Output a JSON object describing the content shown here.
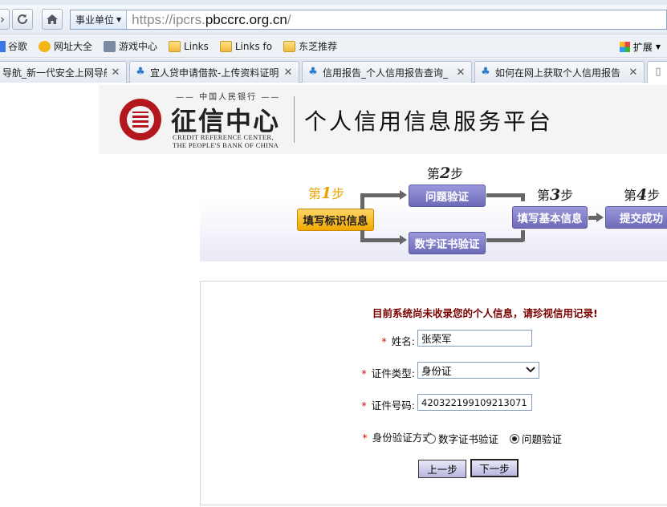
{
  "browser": {
    "zone_label": "事业单位",
    "url_prefix": "https://ipcrs.",
    "url_domain": "pbccrc.org.cn",
    "url_suffix": "/",
    "bookmarks": [
      {
        "label": "谷歌",
        "icon": "google-icon"
      },
      {
        "label": "网址大全",
        "icon": "nav-icon"
      },
      {
        "label": "游戏中心",
        "icon": "game-icon"
      },
      {
        "label": "Links",
        "icon": "folder-icon"
      },
      {
        "label": "Links fo",
        "icon": "folder-icon"
      },
      {
        "label": "东芝推荐",
        "icon": "folder-icon"
      }
    ],
    "extensions_label": "扩展",
    "tabs": [
      {
        "title": "导航_新一代安全上网导航"
      },
      {
        "title": "宜人贷申请借款-上传资料证明"
      },
      {
        "title": "信用报告_个人信用报告查询_"
      },
      {
        "title": "如何在网上获取个人信用报告"
      }
    ]
  },
  "banner": {
    "bank_cn": "中国人民银行",
    "center_name": "征信中心",
    "en_line1": "CREDIT REFERENCE CENTER,",
    "en_line2": "THE PEOPLE'S BANK OF CHINA",
    "platform_title": "个人信用信息服务平台"
  },
  "steps": {
    "step1_prefix": "第",
    "step1_num": "1",
    "step1_suffix": "步",
    "step2_prefix": "第",
    "step2_num": "2",
    "step2_suffix": "步",
    "step3_prefix": "第",
    "step3_num": "3",
    "step3_suffix": "步",
    "step4_prefix": "第",
    "step4_num": "4",
    "step4_suffix": "步",
    "fill_identity": "填写标识信息",
    "question_verify": "问题验证",
    "cert_verify": "数字证书验证",
    "fill_basic": "填写基本信息",
    "submit_success": "提交成功"
  },
  "form": {
    "notice": "目前系统尚未收录您的个人信息，请珍视信用记录!",
    "name_label": "姓名:",
    "name_value": "张荣军",
    "id_type_label": "证件类型:",
    "id_type_value": "身份证",
    "id_number_label": "证件号码:",
    "id_number_value": "420322199109213071",
    "verify_method_label": "身份验证方式:",
    "option_cert": "数字证书验证",
    "option_question": "问题验证",
    "selected_option": "问题验证",
    "prev_button": "上一步",
    "next_button": "下一步"
  }
}
